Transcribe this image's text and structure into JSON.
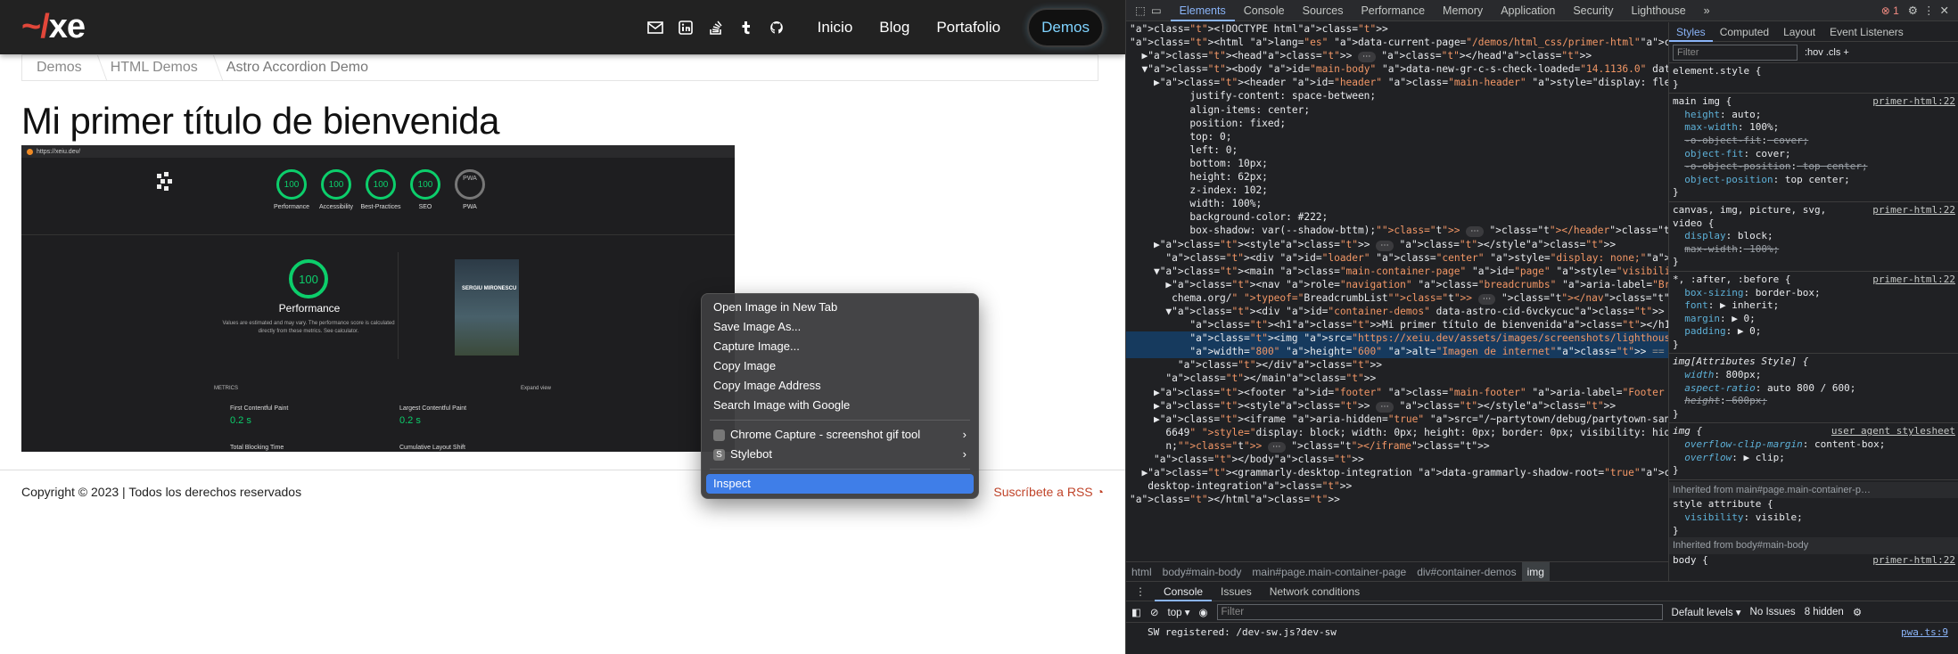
{
  "site": {
    "logo": {
      "tilde": "~/",
      "rest": "xe"
    },
    "social_icons": [
      "mail-icon",
      "linkedin-icon",
      "stackoverflow-icon",
      "tumblr-icon",
      "github-icon"
    ],
    "nav": [
      "Inicio",
      "Blog",
      "Portafolio",
      "Demos"
    ],
    "breadcrumbs": [
      "Demos",
      "HTML Demos",
      "Astro Accordion Demo"
    ],
    "title": "Mi primer título de bienvenida",
    "screenshot": {
      "url": "https://xeiu.dev/",
      "gauges": [
        {
          "value": "100",
          "label": "Performance"
        },
        {
          "value": "100",
          "label": "Accessibility"
        },
        {
          "value": "100",
          "label": "Best-Practices"
        },
        {
          "value": "100",
          "label": "SEO"
        },
        {
          "value": "PWA",
          "label": "PWA"
        }
      ],
      "big_score": "100",
      "perf_title": "Performance",
      "perf_desc": "Values are estimated and may vary. The performance score is calculated directly from these metrics. See calculator.",
      "phone_text": "SERGIU MIRONESCU",
      "metrics_label": "METRICS",
      "expand_label": "Expand view",
      "metrics": [
        {
          "name": "First Contentful Paint",
          "value": "0.2 s"
        },
        {
          "name": "Largest Contentful Paint",
          "value": "0.2 s"
        },
        {
          "name": "Total Blocking Time",
          "value": ""
        },
        {
          "name": "Cumulative Layout Shift",
          "value": ""
        }
      ]
    },
    "footer": {
      "copyright": "Copyright © 2023 | Todos los derechos reservados",
      "rss": "Suscríbete a RSS"
    }
  },
  "context_menu": {
    "group1": [
      "Open Image in New Tab",
      "Save Image As...",
      "Capture Image...",
      "Copy Image",
      "Copy Image Address",
      "Search Image with Google"
    ],
    "group2": [
      {
        "label": "Chrome Capture - screenshot  gif tool",
        "submenu": true
      },
      {
        "label": "Stylebot",
        "submenu": true
      }
    ],
    "inspect": "Inspect"
  },
  "devtools": {
    "tabs": [
      "Elements",
      "Console",
      "Sources",
      "Performance",
      "Memory",
      "Application",
      "Security",
      "Lighthouse"
    ],
    "active_tab": "Elements",
    "error_count": "1",
    "dom_lines": [
      "<!DOCTYPE html>",
      "<html lang=\"es\" data-current-page=\"/demos/html_css/primer-html\">",
      "  ▶<head> ⋯ </head>",
      "  ▼<body id=\"main-body\" data-new-gr-c-s-check-loaded=\"14.1136.0\" data-gr-ext-installed>",
      "    ▶<header id=\"header\" class=\"main-header\" style=\"display: flex;",
      "          justify-content: space-between;",
      "          align-items: center;",
      "          position: fixed;",
      "          top: 0;",
      "          left: 0;",
      "          bottom: 10px;",
      "          height: 62px;",
      "          z-index: 102;",
      "          width: 100%;",
      "          background-color: #222;",
      "          box-shadow: var(--shadow-bttm);\"> ⋯ </header>",
      "    ▶<style> ⋯ </style>",
      "      <div id=\"loader\" class=\"center\" style=\"display: none;\"></div>",
      "    ▼<main class=\"main-container-page\" id=\"page\" style=\"visibility: visible;\">",
      "      ▶<nav role=\"navigation\" class=\"breadcrumbs\" aria-label=\"Breadcrumb\" vocab=\"https://s",
      "       chema.org/\" typeof=\"BreadcrumbList\"> ⋯ </nav>",
      "      ▼<div id=\"container-demos\" data-astro-cid-6vckycuc>",
      "          <h1>Mi primer título de bienvenida</h1>",
      "          <img src=\"https://xeiu.dev/assets/images/screenshots/lighthouse-score-min.png\"",
      "          width=\"800\" height=\"600\" alt=\"Imagen de internet\"> == $0",
      "        </div>",
      "      </main>",
      "    ▶<footer id=\"footer\" class=\"main-footer\" aria-label=\"Footer Principal\"> ⋯ </footer>",
      "    ▶<style> ⋯ </style>",
      "    ▶<iframe aria-hidden=\"true\" src=\"/~partytown/debug/partytown-sandbox-sw.html?169935826",
      "      6649\" style=\"display: block; width: 0px; height: 0px; border: 0px; visibility: hidde",
      "      n;\"> ⋯ </iframe>",
      "    </body>",
      "  ▶<grammarly-desktop-integration data-grammarly-shadow-root=\"true\"> ⋯ </grammarly-",
      "   desktop-integration>",
      "</html>"
    ],
    "breadcrumb": [
      "html",
      "body#main-body",
      "main#page.main-container-page",
      "div#container-demos",
      "img"
    ],
    "styles_tabs": [
      "Styles",
      "Computed",
      "Layout",
      "Event Listeners"
    ],
    "filter_placeholder": "Filter",
    "filter_tools": ":hov  .cls  +",
    "rules": [
      {
        "selector": "element.style {",
        "source": "",
        "props": []
      },
      {
        "selector": "main img {",
        "source": "primer-html:22",
        "props": [
          "height: auto;",
          "max-width: 100%;",
          "-o-object-fit: cover;",
          "object-fit: cover;",
          "-o-object-position: top center;",
          "object-position: top center;"
        ]
      },
      {
        "selector": "canvas, img, picture, svg,\nvideo {",
        "source": "primer-html:22",
        "props": [
          "display: block;",
          "max-width: 100%;"
        ]
      },
      {
        "selector": "*, :after, :before {",
        "source": "primer-html:22",
        "props": [
          "box-sizing: border-box;",
          "font: ▶ inherit;",
          "margin: ▶ 0;",
          "padding: ▶ 0;"
        ]
      },
      {
        "selector": "img[Attributes Style] {",
        "source": "",
        "props": [
          "width: 800px;",
          "aspect-ratio: auto 800 / 600;",
          "height: 600px;"
        ]
      },
      {
        "selector": "img {",
        "source": "user agent stylesheet",
        "props": [
          "overflow-clip-margin: content-box;",
          "overflow: ▶ clip;"
        ]
      }
    ],
    "inherited1": "Inherited from main#page.main-container-p…",
    "style_attr": {
      "selector": "style attribute {",
      "prop": "visibility: visible;"
    },
    "inherited2": "Inherited from body#main-body",
    "body_rule": {
      "selector": "body {",
      "source": "primer-html:22"
    },
    "drawer_tabs": [
      "Console",
      "Issues",
      "Network conditions"
    ],
    "console_context": "top",
    "console_filter": "Filter",
    "levels": "Default levels",
    "no_issues": "No Issues",
    "hidden": "8 hidden",
    "log": {
      "text": "SW registered:  /dev-sw.js?dev-sw",
      "source": "pwa.ts:9"
    }
  }
}
